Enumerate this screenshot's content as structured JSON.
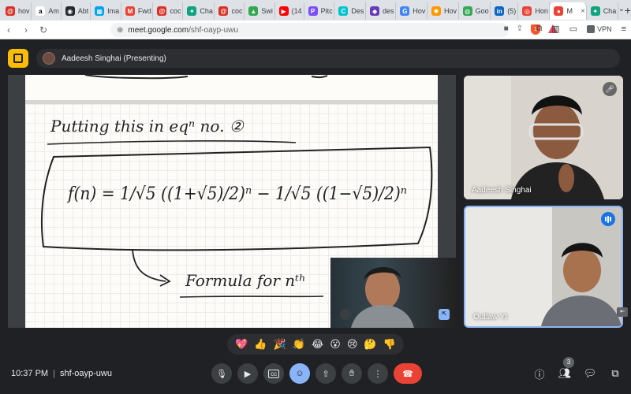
{
  "browser": {
    "tabs": [
      {
        "label": "hov",
        "color": "#d93025",
        "glyph": "@"
      },
      {
        "label": "Am",
        "color": "#ffffff",
        "glyph": "a"
      },
      {
        "label": "Abt",
        "color": "#24292f",
        "glyph": "◉"
      },
      {
        "label": "Ima",
        "color": "#00a4ef",
        "glyph": "▦"
      },
      {
        "label": "Fwd",
        "color": "#ea4335",
        "glyph": "M"
      },
      {
        "label": "coc",
        "color": "#d93025",
        "glyph": "@"
      },
      {
        "label": "Cha",
        "color": "#10a37f",
        "glyph": "✦"
      },
      {
        "label": "coc",
        "color": "#d93025",
        "glyph": "@"
      },
      {
        "label": "Swi",
        "color": "#34a853",
        "glyph": "▲"
      },
      {
        "label": "(14",
        "color": "#ff0000",
        "glyph": "▶"
      },
      {
        "label": "Pitc",
        "color": "#7c4dff",
        "glyph": "P"
      },
      {
        "label": "Des",
        "color": "#00c4cc",
        "glyph": "C"
      },
      {
        "label": "des",
        "color": "#673ab7",
        "glyph": "◆"
      },
      {
        "label": "Hov",
        "color": "#4285f4",
        "glyph": "G"
      },
      {
        "label": "Hov",
        "color": "#ff9800",
        "glyph": "✺"
      },
      {
        "label": "Goo",
        "color": "#34a853",
        "glyph": "◍"
      },
      {
        "label": "(5)",
        "color": "#0a66c2",
        "glyph": "in"
      },
      {
        "label": "Hon",
        "color": "#ea4335",
        "glyph": "◎"
      },
      {
        "label": "M",
        "color": "#ea4335",
        "glyph": "●"
      },
      {
        "label": "Cha",
        "color": "#10a37f",
        "glyph": "✦"
      }
    ],
    "active_tab_index": 18,
    "url_host": "meet.google.com",
    "url_path": "/shf-oayp-uwu",
    "vpn_label": "VPN",
    "brave_badge": "1"
  },
  "meet": {
    "presenter_label": "Aadeesh Singhai (Presenting)",
    "handwriting": {
      "line1": "Putting this in eqⁿ no. ②",
      "formula": "f(n) = 1/√5 ((1+√5)/2)ⁿ − 1/√5 ((1−√5)/2)ⁿ",
      "line3": "Formula for nᵗʰ"
    },
    "participants": [
      {
        "name": "Aadeesh Singhai",
        "muted": true
      },
      {
        "name": "Outlaw Yt",
        "speaking": true
      }
    ],
    "reactions": [
      "💖",
      "👍",
      "🎉",
      "👏",
      "😂",
      "😮",
      "😢",
      "🤔",
      "👎"
    ],
    "time": "10:37 PM",
    "meeting_code": "shf-oayp-uwu",
    "people_count": "3",
    "icons": {
      "mic": "mic-icon",
      "camera": "camera-icon",
      "captions": "captions-icon",
      "emoji": "emoji-icon",
      "present": "present-icon",
      "hand": "raise-hand-icon",
      "more": "more-icon",
      "end": "end-call-icon"
    }
  }
}
